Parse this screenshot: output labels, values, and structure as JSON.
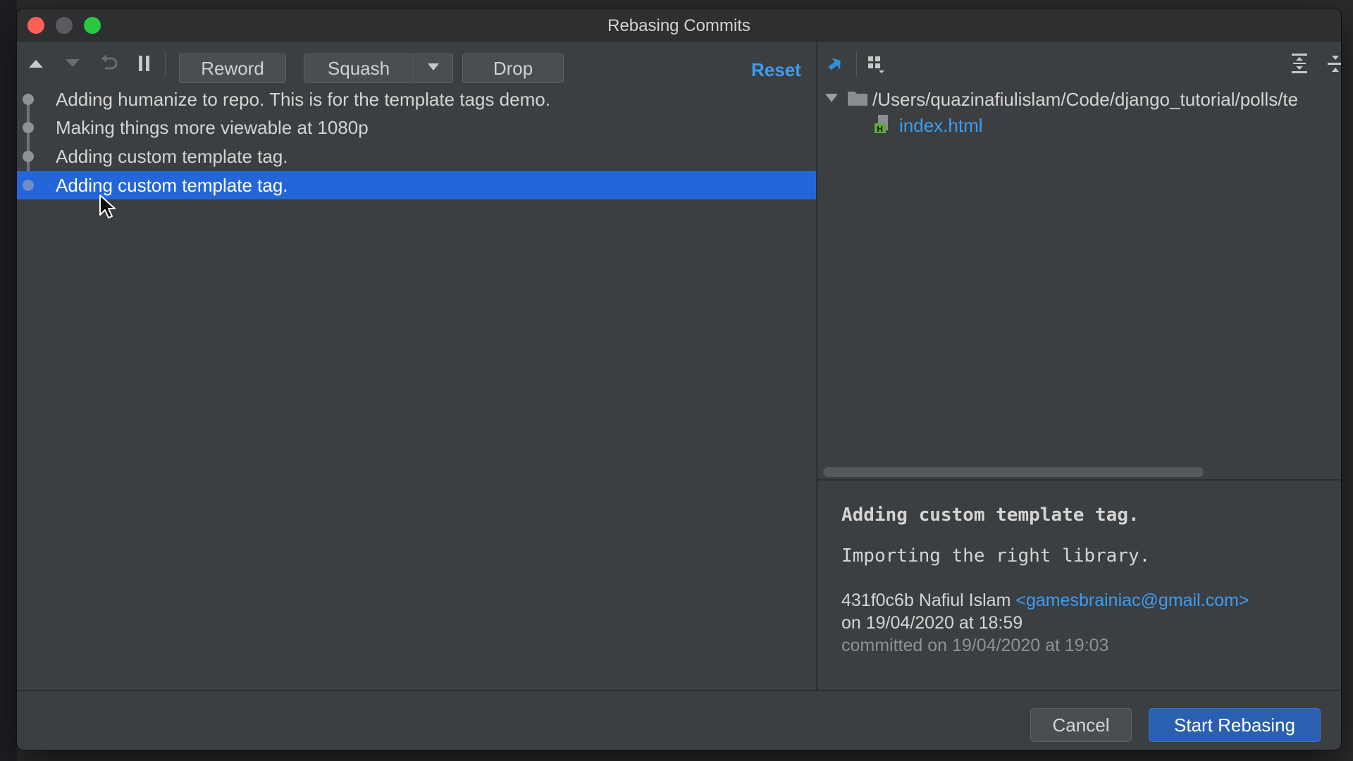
{
  "window": {
    "title": "Rebasing Commits"
  },
  "toolbar": {
    "move_up_icon": "triangle-up-icon",
    "move_down_icon": "triangle-down-icon",
    "undo_icon": "undo-icon",
    "pause_icon": "pause-icon",
    "reword_label": "Reword",
    "squash_label": "Squash",
    "drop_label": "Drop",
    "reset_label": "Reset"
  },
  "commits": [
    {
      "message": "Adding humanize to repo. This is for the template tags demo."
    },
    {
      "message": "Making things more viewable at 1080p"
    },
    {
      "message": "Adding custom template tag."
    },
    {
      "message": "Adding custom template tag.",
      "selected": true
    }
  ],
  "changes": {
    "folder_path": "/Users/quazinafiulislam/Code/django_tutorial/polls/te",
    "file_name": "index.html"
  },
  "details": {
    "subject": "Adding custom template tag.",
    "body": "Importing the right library.",
    "hash_author": "431f0c6b Nafiul Islam ",
    "email": "<gamesbrainiac@gmail.com>",
    "authored": "on 19/04/2020 at 18:59",
    "committed": "committed on 19/04/2020 at 19:03"
  },
  "footer": {
    "cancel_label": "Cancel",
    "start_label": "Start Rebasing"
  },
  "colors": {
    "selection": "#2466d9",
    "link": "#3d9df3",
    "primary_button": "#2b5fb0"
  }
}
